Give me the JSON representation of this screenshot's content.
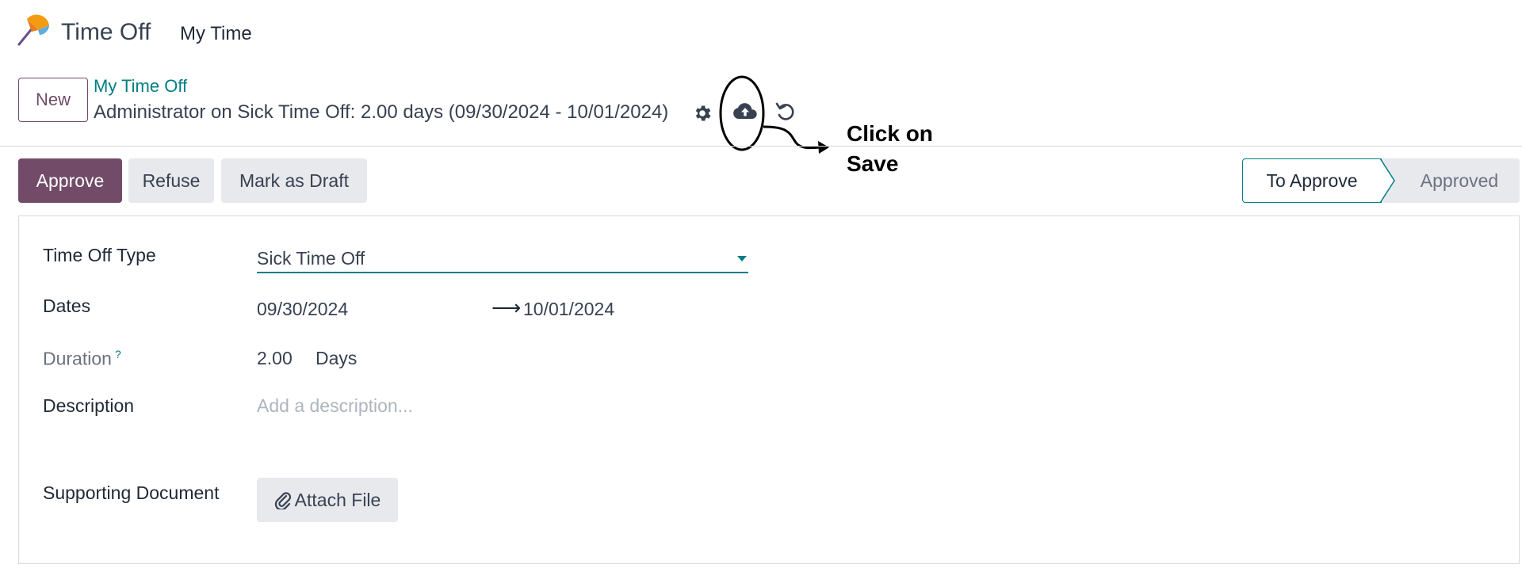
{
  "app": {
    "name": "Time Off",
    "nav_item": "My Time"
  },
  "control_panel": {
    "new_label": "New",
    "breadcrumb": "My Time Off",
    "record_title": "Administrator on Sick Time Off: 2.00 days (09/30/2024 - 10/01/2024)",
    "icons": [
      "gear-icon",
      "cloud-upload-save-icon",
      "discard-undo-icon"
    ]
  },
  "annotation": {
    "line1": "Click on",
    "line2": "Save"
  },
  "actions": {
    "approve": "Approve",
    "refuse": "Refuse",
    "mark_as_draft": "Mark as Draft"
  },
  "status_bar": {
    "stages": [
      "To Approve",
      "Approved"
    ],
    "current": "To Approve"
  },
  "form": {
    "time_off_type": {
      "label": "Time Off Type",
      "value": "Sick Time Off"
    },
    "dates": {
      "label": "Dates",
      "from": "09/30/2024",
      "to": "10/01/2024"
    },
    "duration": {
      "label": "Duration",
      "help": "?",
      "value": "2.00",
      "unit": "Days"
    },
    "description": {
      "label": "Description",
      "placeholder": "Add a description..."
    },
    "supporting_document": {
      "label": "Supporting Document",
      "button": "Attach File"
    }
  },
  "colors": {
    "primary": "#714b67",
    "accent": "#017e84",
    "secondary_bg": "#e7e9ed"
  }
}
